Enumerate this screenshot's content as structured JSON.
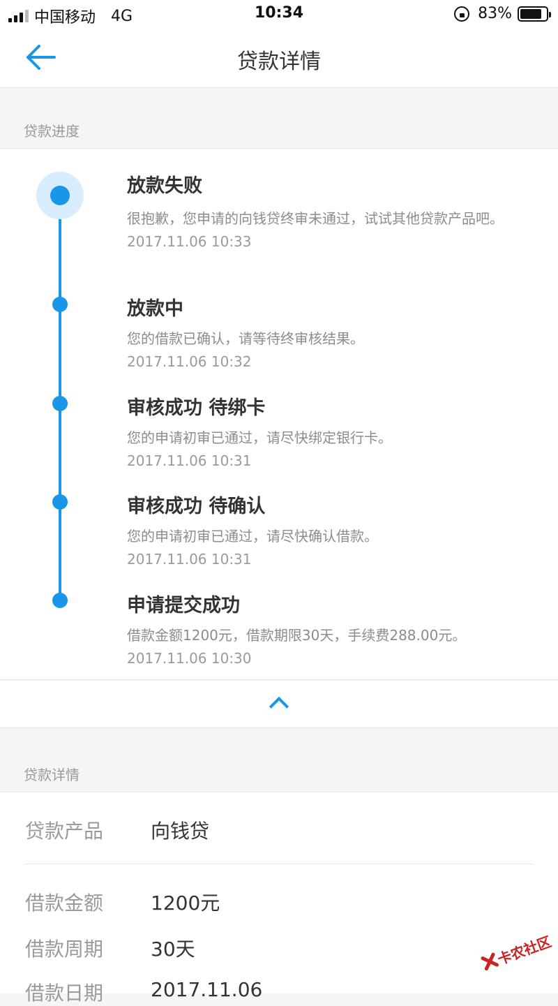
{
  "status_bar": {
    "carrier": "中国移动",
    "network": "4G",
    "time": "10:34",
    "battery": "83%",
    "battery_level": 0.83
  },
  "nav": {
    "title": "贷款详情"
  },
  "progress_section": {
    "header": "贷款进度",
    "steps": [
      {
        "title": "放款失败",
        "desc": "很抱歉，您申请的向钱贷终审未通过，试试其他贷款产品吧。",
        "time": "2017.11.06 10:33"
      },
      {
        "title": "放款中",
        "desc": "您的借款已确认，请等待终审核结果。",
        "time": "2017.11.06 10:32"
      },
      {
        "title": "审核成功 待绑卡",
        "desc": "您的申请初审已通过，请尽快绑定银行卡。",
        "time": "2017.11.06 10:31"
      },
      {
        "title": "审核成功 待确认",
        "desc": "您的申请初审已通过，请尽快确认借款。",
        "time": "2017.11.06 10:31"
      },
      {
        "title": "申请提交成功",
        "desc": "借款金额1200元，借款期限30天，手续费288.00元。",
        "time": "2017.11.06 10:30"
      }
    ]
  },
  "details_section": {
    "header": "贷款详情",
    "rows": [
      {
        "label": "贷款产品",
        "value": "向钱贷"
      },
      {
        "label": "借款金额",
        "value": "1200元"
      },
      {
        "label": "借款周期",
        "value": "30天"
      },
      {
        "label": "借款日期",
        "value": "2017.11.06"
      }
    ]
  },
  "watermark": {
    "text": "卡农社区"
  },
  "colors": {
    "accent": "#1a96e8",
    "halo": "#d7ecfc"
  }
}
